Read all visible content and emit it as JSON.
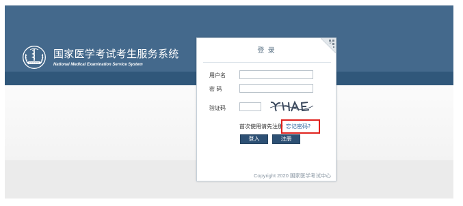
{
  "header": {
    "title": "国家医学考试考生服务系统",
    "subtitle": "National Medical Examination Service System",
    "logo_icon": "medical-emblem-logo"
  },
  "login": {
    "title": "登 录",
    "username_label": "用户名",
    "password_label": "密 码",
    "captcha_label": "验证码",
    "register_hint": "首次使用请先注册",
    "forgot_password": "忘记密码?",
    "login_button": "登入",
    "register_button": "注册",
    "copyright": "Copyright 2020 国家医学考试中心",
    "qr_icon": "qr-code-icon"
  },
  "colors": {
    "header": "#44698c",
    "header_band": "#30577a",
    "button": "#2d5074",
    "link": "#2f67a0",
    "highlight": "#e0211d"
  }
}
